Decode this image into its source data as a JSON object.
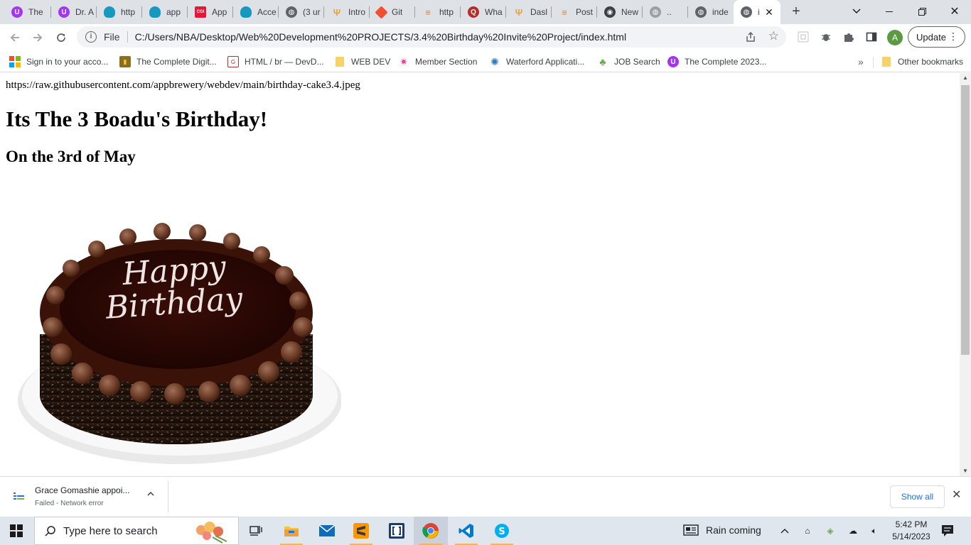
{
  "tabs": [
    {
      "label": "The",
      "icon": "udemy-icon",
      "color": "#a435f0"
    },
    {
      "label": "Dr. A",
      "icon": "udemy-icon",
      "color": "#a435f0"
    },
    {
      "label": "http",
      "icon": "salesforce-cloud-icon",
      "color": "#1798c1"
    },
    {
      "label": "app",
      "icon": "salesforce-cloud-icon",
      "color": "#1798c1"
    },
    {
      "label": "App",
      "icon": "cgi-icon",
      "color": "#e31937"
    },
    {
      "label": "Acce",
      "icon": "salesforce-cloud-icon",
      "color": "#1798c1"
    },
    {
      "label": "(3 ur",
      "icon": "globe-icon",
      "color": "#5f6368"
    },
    {
      "label": "Intro",
      "icon": "appbrewery-icon",
      "color": "#e8a33d"
    },
    {
      "label": "Git",
      "icon": "git-icon",
      "color": "#f05133"
    },
    {
      "label": "http",
      "icon": "stackoverflow-icon",
      "color": "#f48024"
    },
    {
      "label": "Wha",
      "icon": "quora-icon",
      "color": "#b92b27"
    },
    {
      "label": "Dasl",
      "icon": "appbrewery-icon",
      "color": "#e8a33d"
    },
    {
      "label": "Post",
      "icon": "stackoverflow-icon",
      "color": "#f48024"
    },
    {
      "label": "New",
      "icon": "github-icon",
      "color": "#3c4043"
    },
    {
      "label": "..",
      "icon": "globe-icon",
      "color": "#9aa0a6"
    },
    {
      "label": "inde",
      "icon": "globe-icon",
      "color": "#5f6368"
    },
    {
      "label": "i",
      "icon": "globe-icon",
      "color": "#5f6368",
      "active": true
    }
  ],
  "omnibox": {
    "scheme": "File",
    "url": "C:/Users/NBA/Desktop/Web%20Development%20PROJECTS/3.4%20Birthday%20Invite%20Project/index.html"
  },
  "profile": {
    "initial": "A",
    "color": "#5b9a41"
  },
  "update_label": "Update",
  "bookmarks": [
    {
      "label": "Sign in to your acco...",
      "icon": "microsoft-icon"
    },
    {
      "label": "The Complete Digit...",
      "icon": "bookmark-book-icon"
    },
    {
      "label": "HTML / br — DevD...",
      "icon": "devdocs-icon"
    },
    {
      "label": "WEB DEV",
      "icon": "folder-icon"
    },
    {
      "label": "Member Section",
      "icon": "sparkle-icon"
    },
    {
      "label": "Waterford Applicati...",
      "icon": "waterford-icon"
    },
    {
      "label": "JOB Search",
      "icon": "android-icon"
    },
    {
      "label": "The Complete 2023...",
      "icon": "udemy-icon"
    }
  ],
  "other_bookmarks": "Other bookmarks",
  "page": {
    "image_url_text": "https://raw.githubusercontent.com/appbrewery/webdev/main/birthday-cake3.4.jpeg",
    "heading": "Its The 3 Boadu's Birthday!",
    "subheading": "On the 3rd of May",
    "cake_text_line1": "Happy",
    "cake_text_line2": "Birthday"
  },
  "download": {
    "name": "Grace Gomashie appoi...",
    "status": "Failed - Network error",
    "show_all": "Show all"
  },
  "taskbar": {
    "search_placeholder": "Type here to search",
    "weather": "Rain coming",
    "time": "5:42 PM",
    "date": "5/14/2023"
  }
}
